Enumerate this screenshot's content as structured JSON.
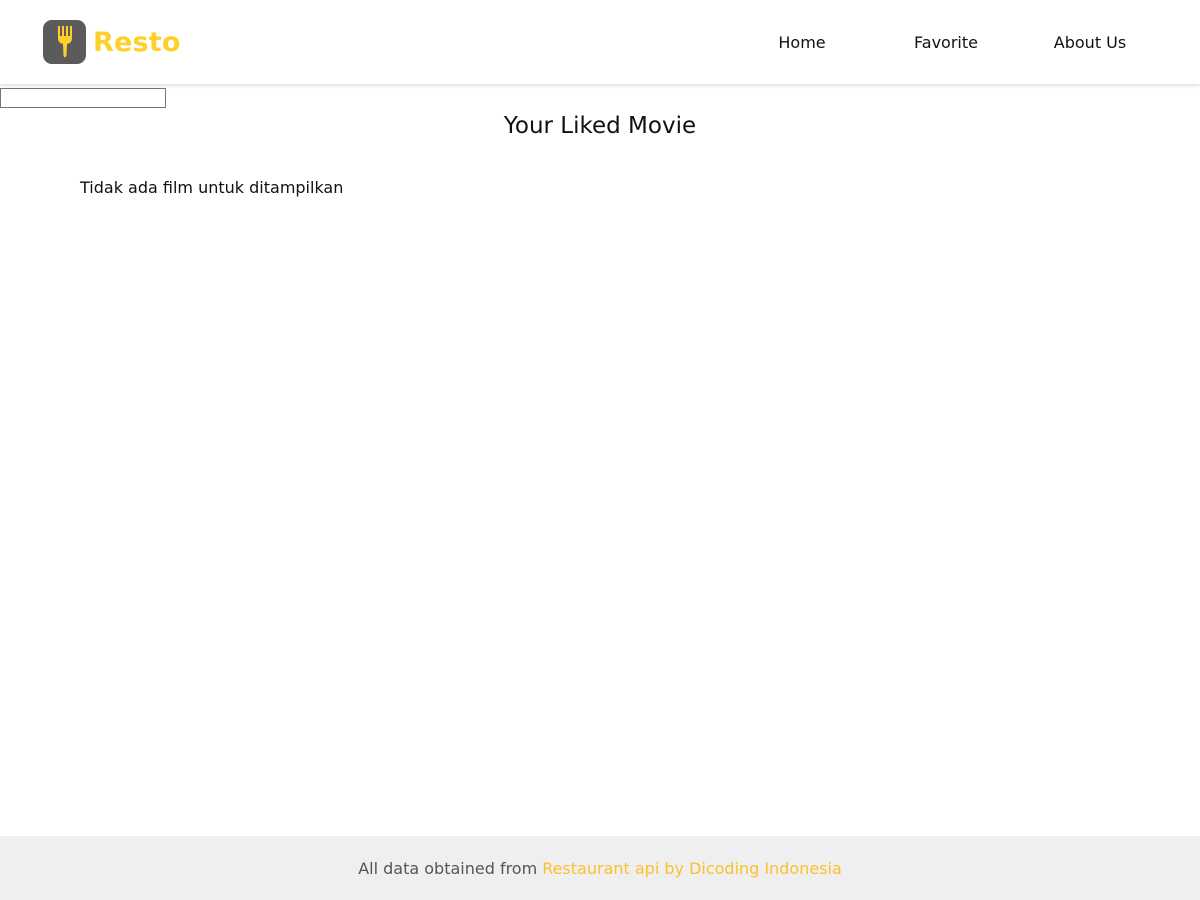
{
  "header": {
    "brand_name": "Resto",
    "logo_icon": "fork-icon",
    "nav": [
      {
        "label": "Home"
      },
      {
        "label": "Favorite"
      },
      {
        "label": "About Us"
      }
    ]
  },
  "main": {
    "title": "Your Liked Movie",
    "empty_message": "Tidak ada film untuk ditampilkan"
  },
  "footer": {
    "text": "All data obtained from",
    "link_text": "Restaurant api by Dicoding Indonesia"
  },
  "colors": {
    "brand": "#ffd02a",
    "logo_background": "#5b5b5b",
    "footer_background": "#efefef",
    "link": "#fbc02d"
  }
}
